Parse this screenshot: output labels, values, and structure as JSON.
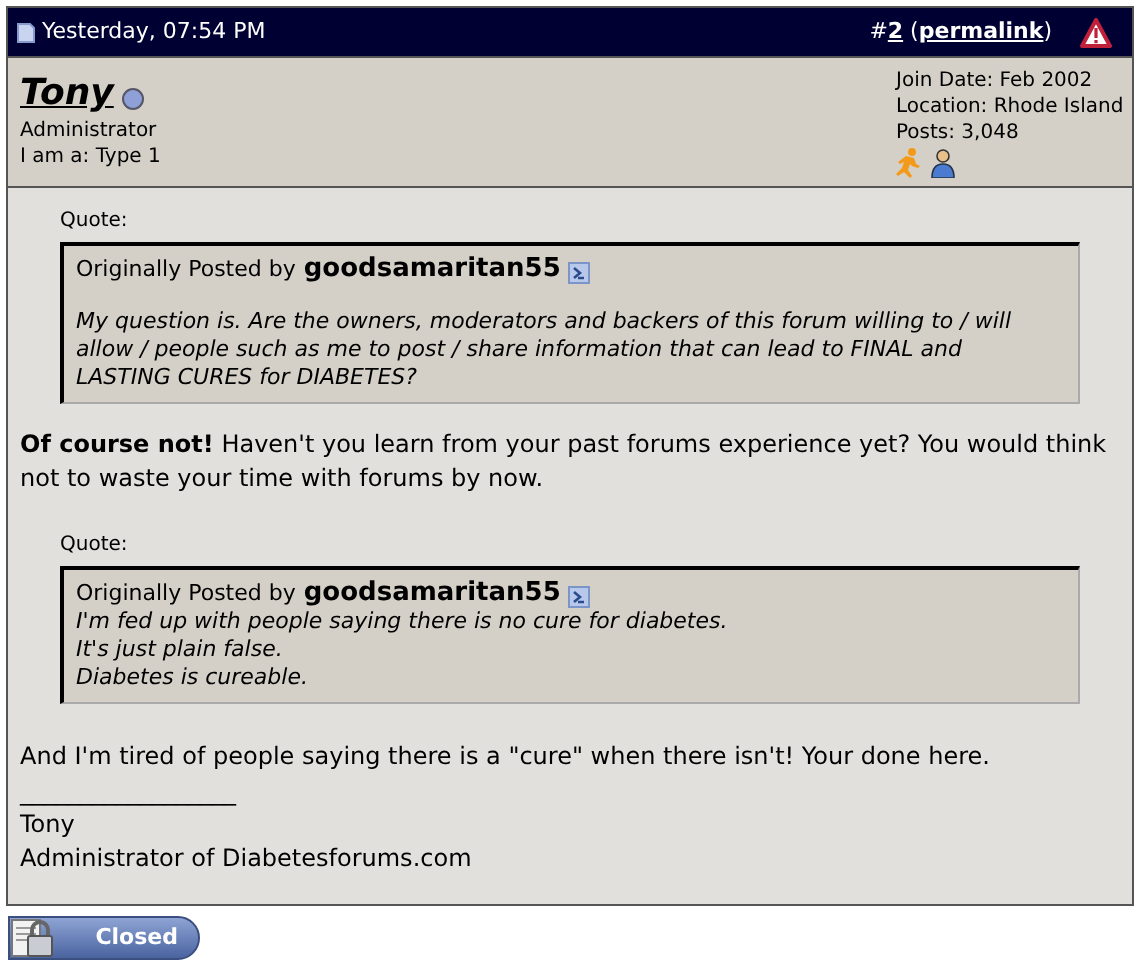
{
  "post_header": {
    "timestamp": "Yesterday, 07:54 PM",
    "hash": "#",
    "post_number": "2",
    "permalink_open": "(",
    "permalink": "permalink",
    "permalink_close": ")"
  },
  "user": {
    "name": "Tony",
    "online": true,
    "title": "Administrator",
    "type": "I am a: Type 1",
    "join_date": "Join Date: Feb 2002",
    "location": "Location: Rhode Island",
    "posts": "Posts: 3,048"
  },
  "blocks": [
    {
      "kind": "quote",
      "label": "Quote:",
      "posted_by": "Originally Posted by",
      "author": "goodsamaritan55",
      "lines": [
        "My question is. Are the owners, moderators and backers of this forum willing to / will allow / people such as me to post / share information that can lead to FINAL and LASTING CURES for DIABETES?"
      ]
    },
    {
      "kind": "text",
      "text": "**Of course not!** Haven't you learn from your past forums experience yet? You would think not to waste your time with forums by now."
    },
    {
      "kind": "quote",
      "label": "Quote:",
      "posted_by": "Originally Posted by",
      "author": "goodsamaritan55",
      "lines": [
        "I'm fed up with people saying there is no cure for diabetes.",
        "It's just plain false.",
        "Diabetes is cureable."
      ]
    },
    {
      "kind": "text",
      "text": "And I'm tired of people saying there is a \"cure\" when there isn't! Your done here."
    }
  ],
  "signature": {
    "rule": "__________________",
    "lines": [
      "Tony",
      "Administrator of Diabetesforums.com"
    ]
  },
  "closed_button": "Closed"
}
